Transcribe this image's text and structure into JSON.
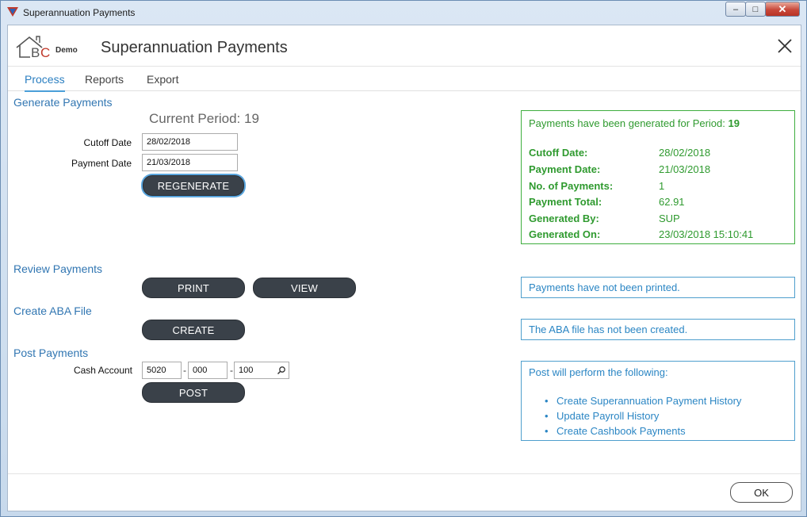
{
  "window": {
    "title": "Superannuation Payments",
    "minimize": "‒",
    "maximize": "□",
    "close": "✕"
  },
  "header": {
    "logo_demo": "Demo",
    "title": "Superannuation Payments"
  },
  "tabs": [
    {
      "label": "Process",
      "active": true
    },
    {
      "label": "Reports",
      "active": false
    },
    {
      "label": "Export",
      "active": false
    }
  ],
  "generate": {
    "section_title": "Generate Payments",
    "current_period": "Current Period: 19",
    "cutoff_label": "Cutoff Date",
    "cutoff_value": "28/02/2018",
    "payment_label": "Payment Date",
    "payment_value": "21/03/2018",
    "regenerate_label": "REGENERATE"
  },
  "generated_info": {
    "heading": "Payments have been generated for Period: ",
    "period": "19",
    "rows": [
      {
        "label": "Cutoff Date:",
        "value": "28/02/2018"
      },
      {
        "label": "Payment Date:",
        "value": "21/03/2018"
      },
      {
        "label": "No. of Payments:",
        "value": "1"
      },
      {
        "label": "Payment Total:",
        "value": "62.91"
      },
      {
        "label": "Generated By:",
        "value": "SUP"
      },
      {
        "label": "Generated On:",
        "value": "23/03/2018 15:10:41"
      }
    ]
  },
  "review": {
    "section_title": "Review Payments",
    "print_label": "PRINT",
    "view_label": "VIEW",
    "status": "Payments have not been printed."
  },
  "aba": {
    "section_title": "Create ABA File",
    "create_label": "CREATE",
    "status": "The ABA file has not been created."
  },
  "post": {
    "section_title": "Post Payments",
    "cash_account_label": "Cash Account",
    "account_part1": "5020",
    "account_part2": "000",
    "account_part3": "100",
    "dash": "-",
    "post_label": "POST",
    "info_heading": "Post will perform the following:",
    "info_items": [
      "Create Superannuation Payment History",
      "Update Payroll History",
      "Create Cashbook Payments"
    ]
  },
  "footer": {
    "ok_label": "OK"
  },
  "colors": {
    "accent_blue": "#3176b2",
    "success_green": "#2f9a2f",
    "button_dark": "#3a4149"
  }
}
